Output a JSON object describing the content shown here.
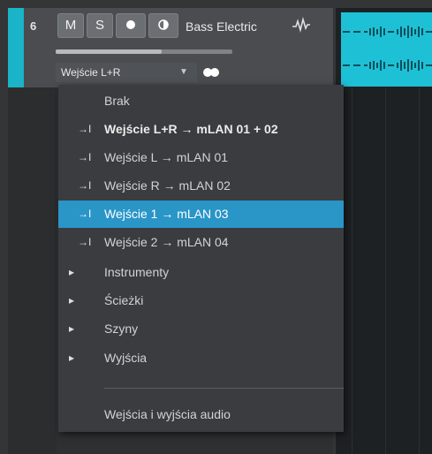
{
  "track": {
    "number": "6",
    "mute_label": "M",
    "solo_label": "S",
    "name": "Bass Electric",
    "input_value": "Wejście L+R",
    "meter_level": 0.6,
    "color": "#1bb3c8"
  },
  "menu": {
    "items": [
      {
        "label": "Brak",
        "glyph": ""
      },
      {
        "label": "Wejście L+R → mLAN 01 + 02",
        "glyph": "→I"
      },
      {
        "label": "Wejście L → mLAN 01",
        "glyph": "→I"
      },
      {
        "label": "Wejście R → mLAN 02",
        "glyph": "→I"
      },
      {
        "label": "Wejście 1 → mLAN 03",
        "glyph": "→I"
      },
      {
        "label": "Wejście 2 → mLAN 04",
        "glyph": "→I"
      },
      {
        "label": "Instrumenty",
        "glyph": "▸"
      },
      {
        "label": "Ścieżki",
        "glyph": "▸"
      },
      {
        "label": "Szyny",
        "glyph": "▸"
      },
      {
        "label": "Wyjścia",
        "glyph": "▸"
      }
    ],
    "footer_label": "Wejścia i wyjścia audio",
    "selected_color": "#2a95c7"
  }
}
